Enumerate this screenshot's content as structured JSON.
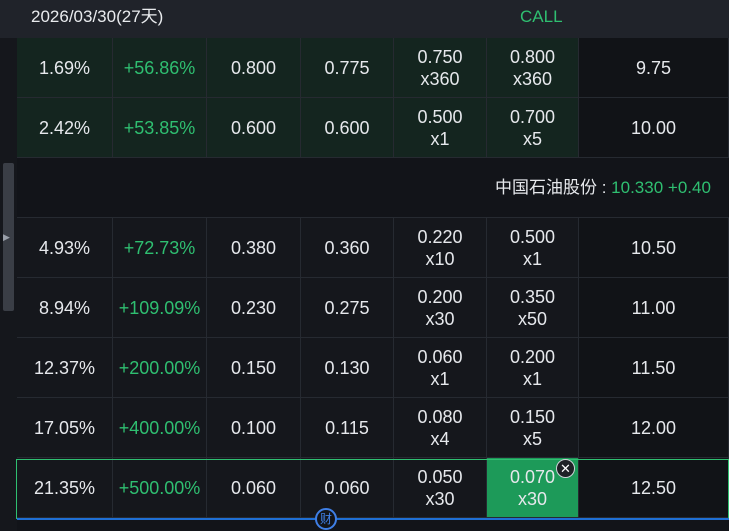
{
  "header": {
    "expiry": "2026/03/30(27天)",
    "type_label": "CALL"
  },
  "underlying": {
    "name_label": "中国石油股份 : ",
    "price_change": "10.330 +0.40"
  },
  "rows_top": [
    {
      "iv": "1.69%",
      "change": "+56.86%",
      "last": "0.800",
      "prev": "0.775",
      "bid": "0.750",
      "bid_size": "x360",
      "ask": "0.800",
      "ask_size": "x360",
      "strike": "9.75"
    },
    {
      "iv": "2.42%",
      "change": "+53.85%",
      "last": "0.600",
      "prev": "0.600",
      "bid": "0.500",
      "bid_size": "x1",
      "ask": "0.700",
      "ask_size": "x5",
      "strike": "10.00"
    }
  ],
  "rows_bottom": [
    {
      "iv": "4.93%",
      "change": "+72.73%",
      "last": "0.380",
      "prev": "0.360",
      "bid": "0.220",
      "bid_size": "x10",
      "ask": "0.500",
      "ask_size": "x1",
      "strike": "10.50"
    },
    {
      "iv": "8.94%",
      "change": "+109.09%",
      "last": "0.230",
      "prev": "0.275",
      "bid": "0.200",
      "bid_size": "x30",
      "ask": "0.350",
      "ask_size": "x50",
      "strike": "11.00"
    },
    {
      "iv": "12.37%",
      "change": "+200.00%",
      "last": "0.150",
      "prev": "0.130",
      "bid": "0.060",
      "bid_size": "x1",
      "ask": "0.200",
      "ask_size": "x1",
      "strike": "11.50"
    },
    {
      "iv": "17.05%",
      "change": "+400.00%",
      "last": "0.100",
      "prev": "0.115",
      "bid": "0.080",
      "bid_size": "x4",
      "ask": "0.150",
      "ask_size": "x5",
      "strike": "12.00"
    },
    {
      "iv": "21.35%",
      "change": "+500.00%",
      "last": "0.060",
      "prev": "0.060",
      "bid": "0.050",
      "bid_size": "x30",
      "ask": "0.070",
      "ask_size": "x30",
      "strike": "12.50"
    }
  ],
  "selection": {
    "close_glyph": "✕"
  },
  "footer": {
    "badge_text": "财"
  },
  "colors": {
    "accent_green": "#2fbf71",
    "itm_bg": "#14251f",
    "selected_ask_bg": "#1d9a59"
  }
}
